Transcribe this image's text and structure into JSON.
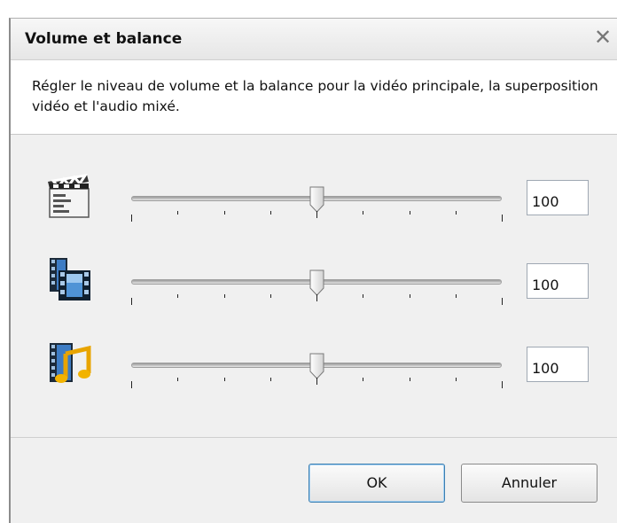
{
  "dialog": {
    "title": "Volume et balance",
    "close_glyph": "✕",
    "description": "Régler le niveau de volume et la balance pour la vidéo principale, la superposition vidéo et l'audio mixé."
  },
  "sliders": [
    {
      "icon": "clapperboard-icon",
      "value": 100,
      "value_text": "100",
      "position_fraction": 0.5
    },
    {
      "icon": "video-overlay-icon",
      "value": 100,
      "value_text": "100",
      "position_fraction": 0.5
    },
    {
      "icon": "video-music-icon",
      "value": 100,
      "value_text": "100",
      "position_fraction": 0.5
    }
  ],
  "tick_count": 9,
  "buttons": {
    "ok_label": "OK",
    "cancel_label": "Annuler"
  },
  "colors": {
    "dialog_bg": "#f0f0f0",
    "content_bg": "#ffffff",
    "ok_border": "#3c7fb1"
  }
}
